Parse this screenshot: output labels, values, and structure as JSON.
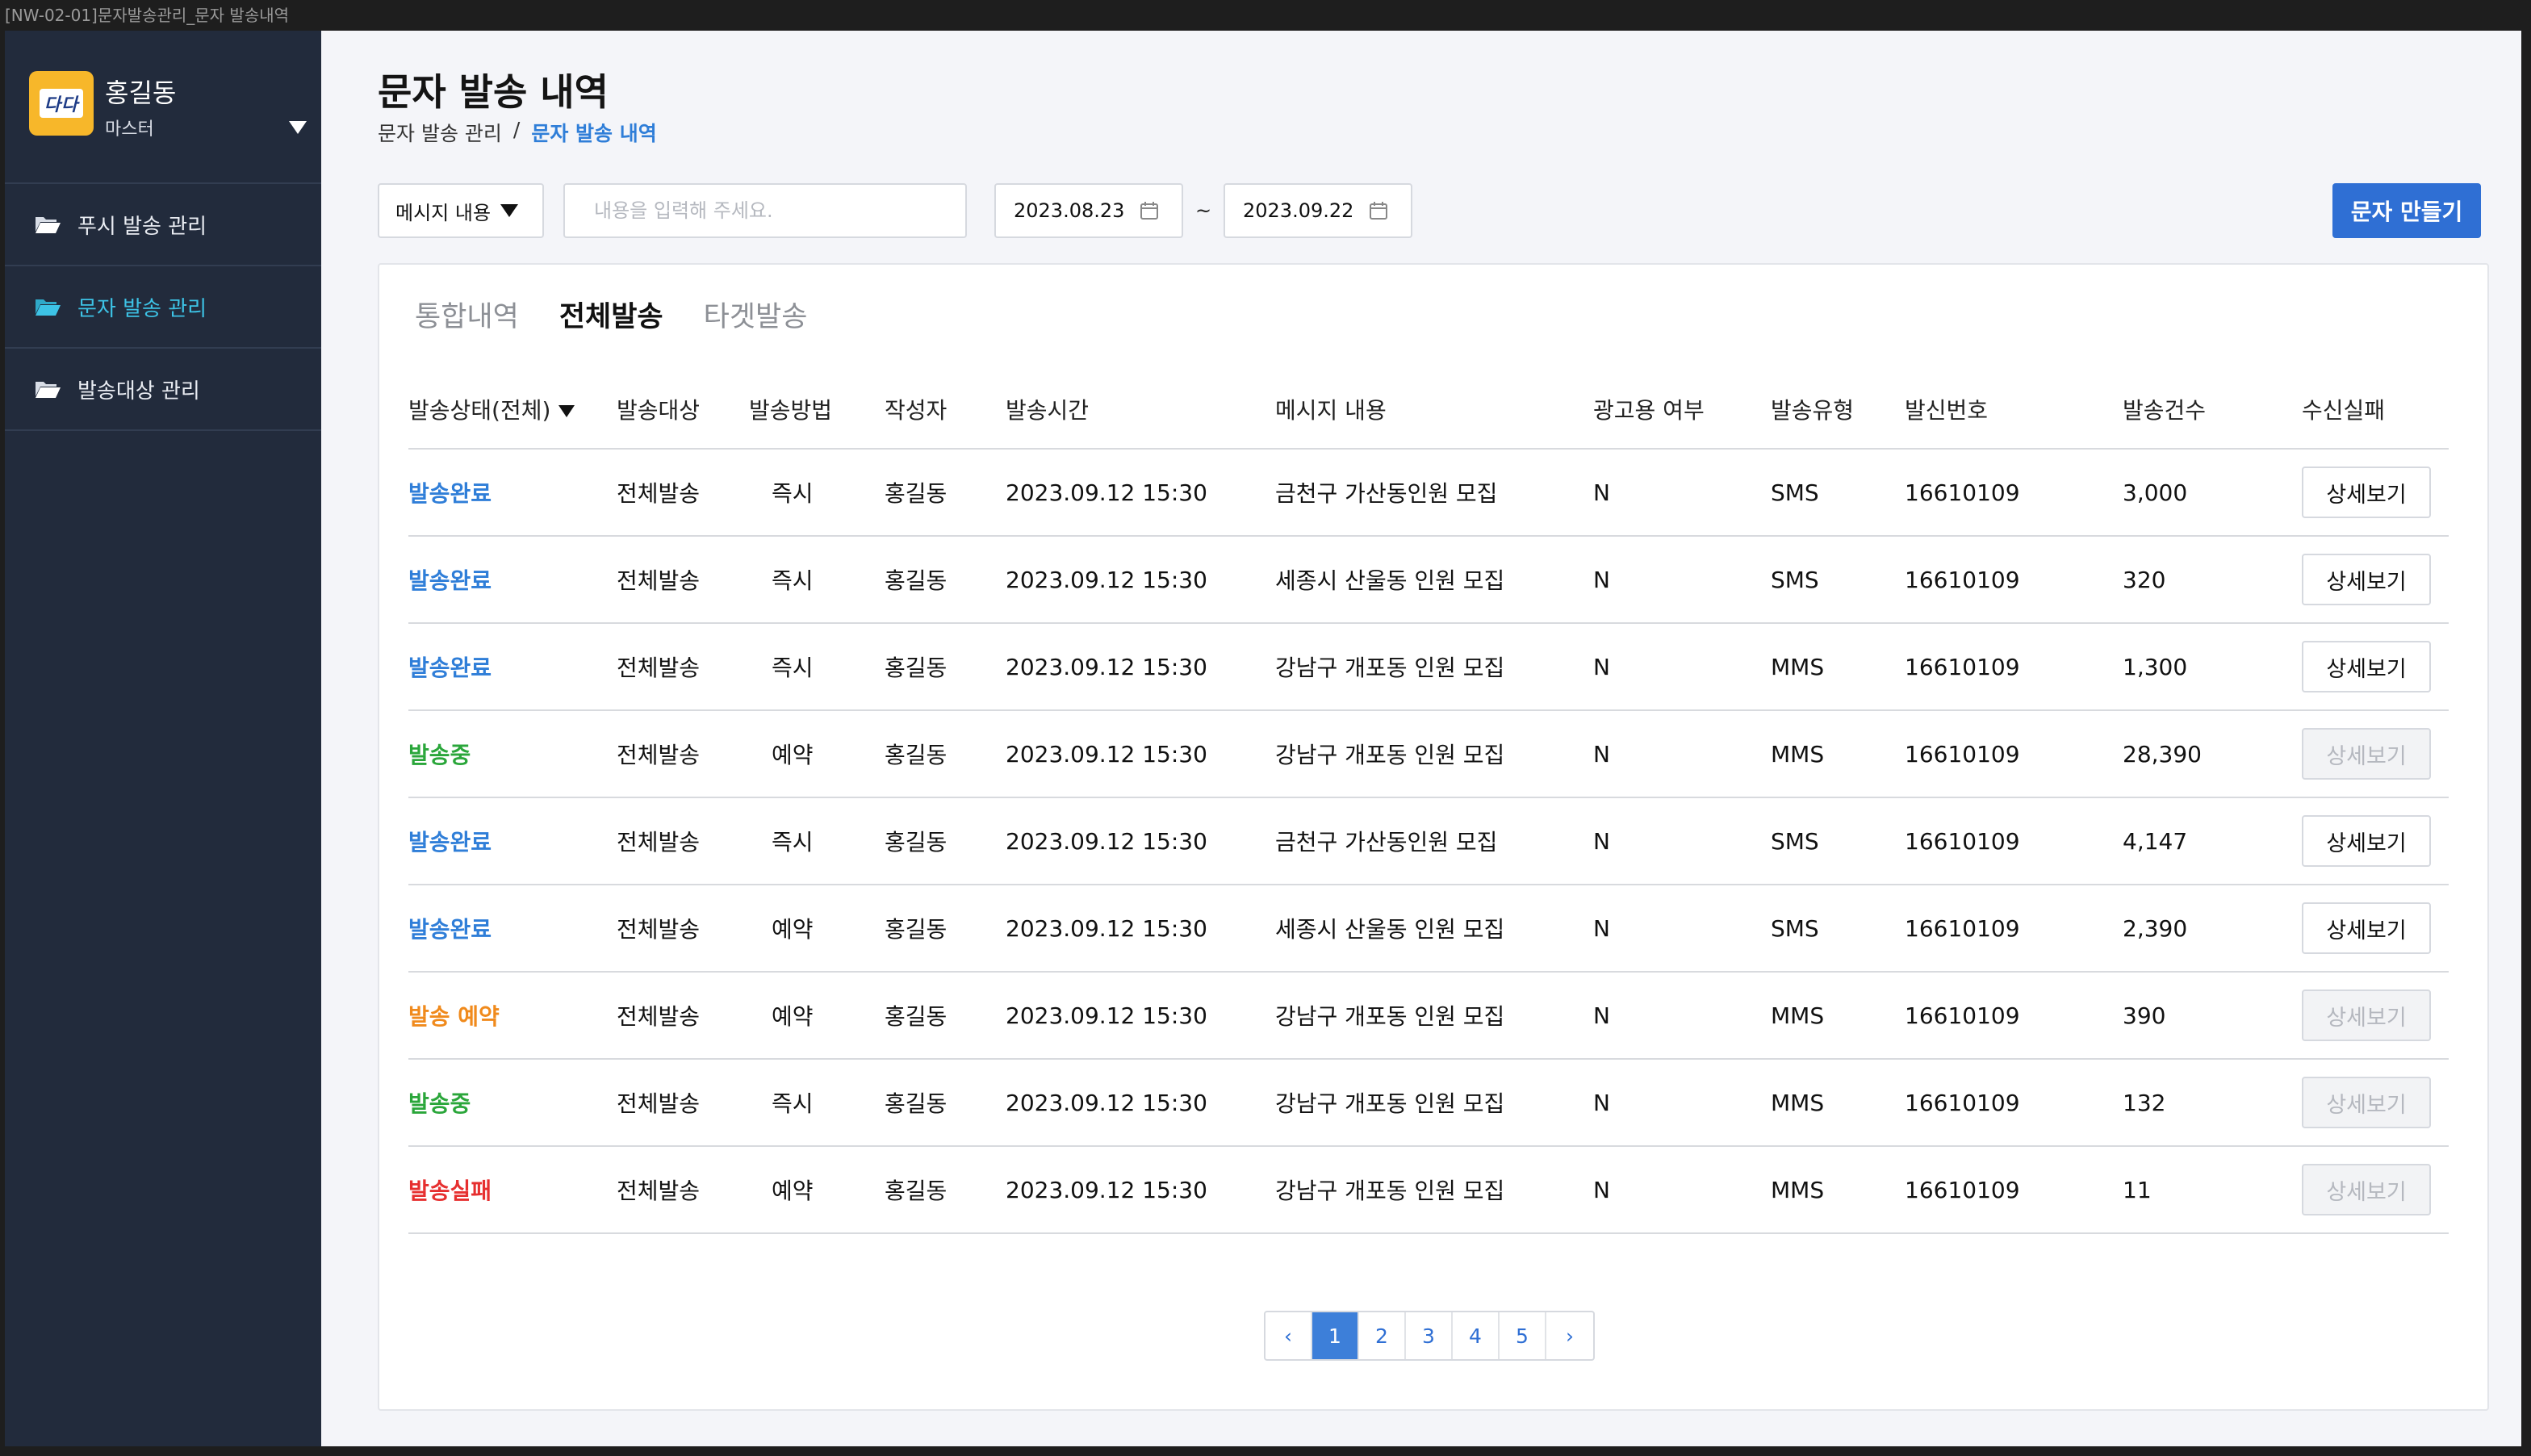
{
  "window": {
    "title": "[NW-02-01]문자발송관리_문자 발송내역"
  },
  "sidebar": {
    "logo_text": "다다",
    "profile": {
      "name": "홍길동",
      "role": "마스터"
    },
    "items": [
      {
        "label": "푸시 발송 관리"
      },
      {
        "label": "문자 발송 관리"
      },
      {
        "label": "발송대상 관리"
      }
    ]
  },
  "header": {
    "title": "문자 발송 내역",
    "breadcrumb": {
      "parent": "문자 발송 관리",
      "separator": "/",
      "current": "문자 발송 내역"
    }
  },
  "filters": {
    "select_label": "메시지 내용",
    "search_placeholder": "내용을 입력해 주세요.",
    "start_date": "2023.08.23",
    "end_date": "2023.09.22",
    "tilde": "~",
    "create_button": "문자 만들기"
  },
  "tabs": [
    {
      "label": "통합내역"
    },
    {
      "label": "전체발송"
    },
    {
      "label": "타겟발송"
    }
  ],
  "table": {
    "headers": [
      "발송상태(전체)",
      "발송대상",
      "발송방법",
      "작성자",
      "발송시간",
      "메시지 내용",
      "광고용 여부",
      "발송유형",
      "발신번호",
      "발송건수",
      "수신실패"
    ],
    "rows": [
      {
        "status": "발송완료",
        "target": "전체발송",
        "method": "즉시",
        "author": "홍길동",
        "time": "2023.09.12 15:30",
        "message": "금천구 가산동인원 모집",
        "ad": "N",
        "type": "SMS",
        "sender": "16610109",
        "count": "3,000",
        "detail": "상세보기"
      },
      {
        "status": "발송완료",
        "target": "전체발송",
        "method": "즉시",
        "author": "홍길동",
        "time": "2023.09.12 15:30",
        "message": "세종시 산울동 인원 모집",
        "ad": "N",
        "type": "SMS",
        "sender": "16610109",
        "count": "320",
        "detail": "상세보기"
      },
      {
        "status": "발송완료",
        "target": "전체발송",
        "method": "즉시",
        "author": "홍길동",
        "time": "2023.09.12 15:30",
        "message": "강남구 개포동 인원 모집",
        "ad": "N",
        "type": "MMS",
        "sender": "16610109",
        "count": "1,300",
        "detail": "상세보기"
      },
      {
        "status": "발송중",
        "target": "전체발송",
        "method": "예약",
        "author": "홍길동",
        "time": "2023.09.12 15:30",
        "message": "강남구 개포동 인원 모집",
        "ad": "N",
        "type": "MMS",
        "sender": "16610109",
        "count": "28,390",
        "detail": "상세보기"
      },
      {
        "status": "발송완료",
        "target": "전체발송",
        "method": "즉시",
        "author": "홍길동",
        "time": "2023.09.12 15:30",
        "message": "금천구 가산동인원 모집",
        "ad": "N",
        "type": "SMS",
        "sender": "16610109",
        "count": "4,147",
        "detail": "상세보기"
      },
      {
        "status": "발송완료",
        "target": "전체발송",
        "method": "예약",
        "author": "홍길동",
        "time": "2023.09.12 15:30",
        "message": "세종시 산울동 인원 모집",
        "ad": "N",
        "type": "SMS",
        "sender": "16610109",
        "count": "2,390",
        "detail": "상세보기"
      },
      {
        "status": "발송 예약",
        "target": "전체발송",
        "method": "예약",
        "author": "홍길동",
        "time": "2023.09.12 15:30",
        "message": "강남구 개포동 인원 모집",
        "ad": "N",
        "type": "MMS",
        "sender": "16610109",
        "count": "390",
        "detail": "상세보기"
      },
      {
        "status": "발송중",
        "target": "전체발송",
        "method": "즉시",
        "author": "홍길동",
        "time": "2023.09.12 15:30",
        "message": "강남구 개포동 인원 모집",
        "ad": "N",
        "type": "MMS",
        "sender": "16610109",
        "count": "132",
        "detail": "상세보기"
      },
      {
        "status": "발송실패",
        "target": "전체발송",
        "method": "예약",
        "author": "홍길동",
        "time": "2023.09.12 15:30",
        "message": "강남구 개포동 인원 모집",
        "ad": "N",
        "type": "MMS",
        "sender": "16610109",
        "count": "11",
        "detail": "상세보기"
      }
    ]
  },
  "pagination": {
    "prev": "‹",
    "pages": [
      "1",
      "2",
      "3",
      "4",
      "5"
    ],
    "next": "›",
    "current": "1"
  },
  "colors": {
    "sidebar_bg": "#222b3c",
    "accent": "#2f6fd4",
    "active_nav": "#3dc3e6",
    "status_done": "#2f7ed8",
    "status_sending": "#2aa63a",
    "status_reserved": "#f08a1c",
    "status_failed": "#e62f2f"
  },
  "icons": {
    "folder": "folder-icon",
    "calendar": "calendar-icon",
    "dropdown": "caret-down-icon"
  }
}
